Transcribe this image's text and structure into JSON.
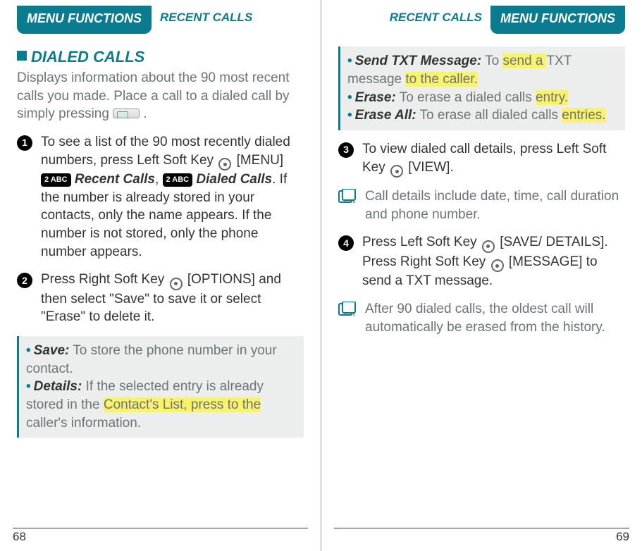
{
  "tabs": {
    "menu": "MENU FUNCTIONS",
    "recent": "RECENT CALLS"
  },
  "left": {
    "section_title": "DIALED CALLS",
    "intro_a": "Displays information about the 90 most recent calls you made. Place a call to a dialed call by simply pressing ",
    "intro_b": " .",
    "step1_a": "To see a list of the 90 most recently dialed numbers, press Left Soft Key ",
    "step1_b": " [MENU] ",
    "step1_c": "Recent Calls",
    "step1_d": ", ",
    "step1_e": "Dialed Calls",
    "step1_f": ". If the number is already stored in your contacts, only the name appears. If the number is not stored, only the phone number appears.",
    "step2_a": "Press Right Soft Key ",
    "step2_b": " [OPTIONS] and then select \"Save\" to save it or select \"Erase\" to delete it.",
    "box": {
      "save_t": "Save:",
      "save": "To store the phone number in your contact.",
      "details_t": "Details:",
      "details_a": "If the selected entry is already stored in the ",
      "details_hl": "Contact's List, press to the ",
      "details_b": "caller's information."
    },
    "key2": "2 ABC",
    "page": "68"
  },
  "right": {
    "box": {
      "send_t": "Send TXT Message:",
      "send_a": "To ",
      "send_hl1": "send a ",
      "send_b": "TXT message ",
      "send_hl2": "to the caller.",
      "erase_t": "Erase:",
      "erase_a": "To erase a dialed calls ",
      "erase_hl": "entry.",
      "eraseall_t": "Erase All:",
      "eraseall_a": "To erase all dialed calls ",
      "eraseall_hl": "entries."
    },
    "step3_a": "To view dialed call details, press Left Soft Key ",
    "step3_b": " [VIEW].",
    "note1": "Call details include date, time, call duration and phone number.",
    "step4_a": "Press Left Soft Key ",
    "step4_b": " [SAVE/ DETAILS]. Press Right Soft Key ",
    "step4_c": " [MESSAGE] to send a TXT message.",
    "note2": "After 90 dialed calls, the oldest call will automatically be erased from the history.",
    "page": "69"
  }
}
